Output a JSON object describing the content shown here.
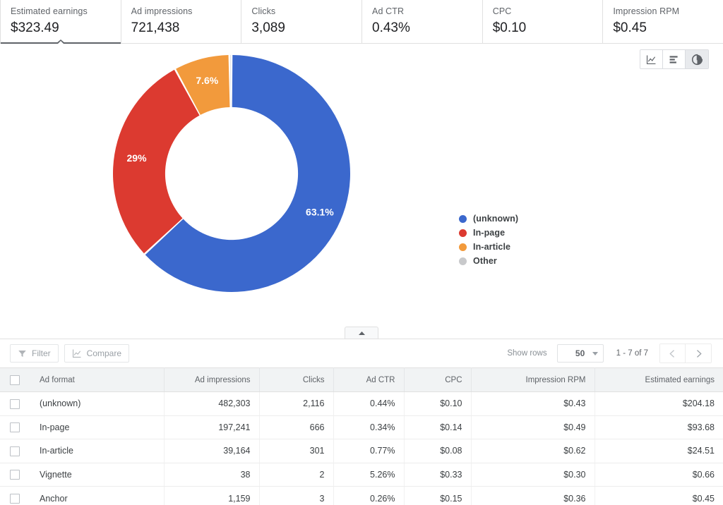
{
  "metrics": [
    {
      "label": "Estimated earnings",
      "value": "$323.49",
      "active": true
    },
    {
      "label": "Ad impressions",
      "value": "721,438",
      "active": false
    },
    {
      "label": "Clicks",
      "value": "3,089",
      "active": false
    },
    {
      "label": "Ad CTR",
      "value": "0.43%",
      "active": false
    },
    {
      "label": "CPC",
      "value": "$0.10",
      "active": false
    },
    {
      "label": "Impression RPM",
      "value": "$0.45",
      "active": false
    }
  ],
  "chart_toggle": {
    "buttons": [
      {
        "icon": "line-chart-icon",
        "selected": false
      },
      {
        "icon": "bar-chart-icon",
        "selected": false
      },
      {
        "icon": "pie-chart-icon",
        "selected": true
      }
    ]
  },
  "chart_data": {
    "type": "pie",
    "variant": "donut",
    "title": "",
    "metric": "Estimated earnings",
    "categories": [
      "(unknown)",
      "In-page",
      "In-article",
      "Other"
    ],
    "values": [
      204.18,
      93.68,
      24.51,
      1.11
    ],
    "value_labels": [
      "63.1%",
      "29%",
      "7.6%",
      ""
    ],
    "percentages": [
      63.1,
      29.0,
      7.6,
      0.3
    ],
    "colors": [
      "#3b68cd",
      "#dc3a30",
      "#f29a3c",
      "#c8c9cb"
    ],
    "legend_position": "right",
    "legend_entries": [
      "(unknown)",
      "In-page",
      "In-article",
      "Other"
    ],
    "inner_radius_ratio": 0.56,
    "start_angle_deg": 0
  },
  "collapse": {
    "icon": "caret-up-icon"
  },
  "table_toolbar": {
    "filter_label": "Filter",
    "filter_icon": "funnel-icon",
    "compare_label": "Compare",
    "compare_icon": "line-chart-icon",
    "show_rows_label": "Show rows",
    "rows_value": "50",
    "page_range": "1 - 7 of 7",
    "prev_icon": "chevron-left-icon",
    "next_icon": "chevron-right-icon"
  },
  "table": {
    "columns": [
      "Ad format",
      "Ad impressions",
      "Clicks",
      "Ad CTR",
      "CPC",
      "Impression RPM",
      "Estimated earnings"
    ],
    "rows": [
      {
        "name": "(unknown)",
        "impressions": "482,303",
        "clicks": "2,116",
        "ctr": "0.44%",
        "cpc": "$0.10",
        "rpm": "$0.43",
        "earnings": "$204.18"
      },
      {
        "name": "In-page",
        "impressions": "197,241",
        "clicks": "666",
        "ctr": "0.34%",
        "cpc": "$0.14",
        "rpm": "$0.49",
        "earnings": "$93.68"
      },
      {
        "name": "In-article",
        "impressions": "39,164",
        "clicks": "301",
        "ctr": "0.77%",
        "cpc": "$0.08",
        "rpm": "$0.62",
        "earnings": "$24.51"
      },
      {
        "name": "Vignette",
        "impressions": "38",
        "clicks": "2",
        "ctr": "5.26%",
        "cpc": "$0.33",
        "rpm": "$0.30",
        "earnings": "$0.66"
      },
      {
        "name": "Anchor",
        "impressions": "1,159",
        "clicks": "3",
        "ctr": "0.26%",
        "cpc": "$0.15",
        "rpm": "$0.36",
        "earnings": "$0.45"
      }
    ]
  }
}
